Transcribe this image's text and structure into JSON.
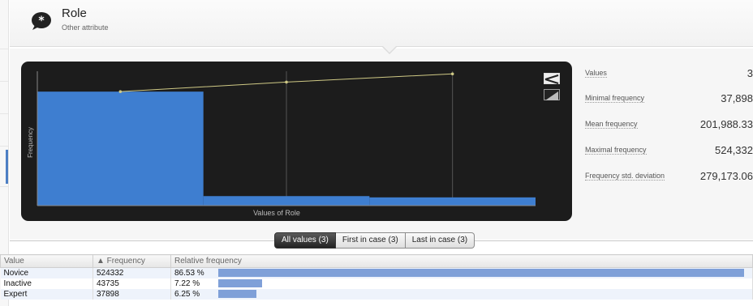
{
  "header": {
    "title": "Role",
    "subtitle": "Other attribute",
    "icon": "asterisk-speech-bubble-icon"
  },
  "chart_data": {
    "type": "bar",
    "categories": [
      "Novice",
      "Inactive",
      "Expert"
    ],
    "values": [
      524332,
      43735,
      37898
    ],
    "overlay_line": {
      "type": "line",
      "name": "cumulative",
      "values": [
        524332,
        568067,
        605965
      ]
    },
    "xlabel": "Values of Role",
    "ylabel": "Frequency",
    "bar_color": "#3e7ed0",
    "line_color": "#cfc985",
    "background": "#1c1c1c"
  },
  "chart_controls": {
    "line_icon": "line-chart-icon",
    "area_icon": "area-chart-icon"
  },
  "stats": [
    {
      "label": "Values",
      "value": "3"
    },
    {
      "label": "Minimal frequency",
      "value": "37,898"
    },
    {
      "label": "Mean frequency",
      "value": "201,988.33"
    },
    {
      "label": "Maximal frequency",
      "value": "524,332"
    },
    {
      "label": "Frequency std. deviation",
      "value": "279,173.06"
    }
  ],
  "tabs": [
    {
      "label": "All values (3)",
      "active": true
    },
    {
      "label": "First in case (3)",
      "active": false
    },
    {
      "label": "Last in case (3)",
      "active": false
    }
  ],
  "table": {
    "columns": [
      "Value",
      "▲ Frequency",
      "Relative frequency"
    ],
    "rows": [
      {
        "value": "Novice",
        "frequency": "524332",
        "relative": "86.53 %",
        "fraction": 0.8653
      },
      {
        "value": "Inactive",
        "frequency": "43735",
        "relative": "7.22 %",
        "fraction": 0.0722
      },
      {
        "value": "Expert",
        "frequency": "37898",
        "relative": "6.25 %",
        "fraction": 0.0625
      }
    ]
  }
}
